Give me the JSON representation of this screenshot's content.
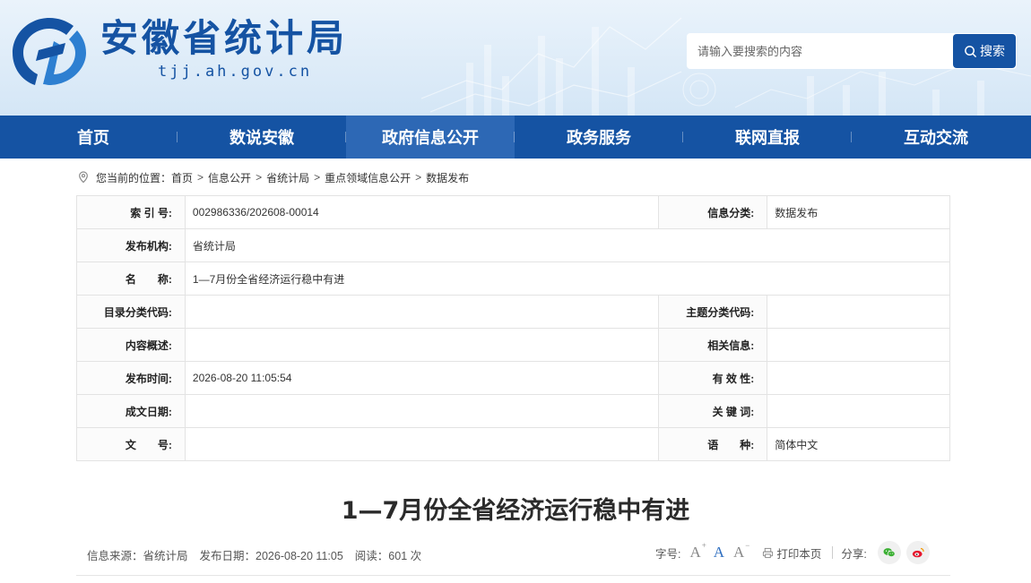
{
  "header": {
    "site_name": "安徽省统计局",
    "site_url": "tjj.ah.gov.cn",
    "search_placeholder": "请输入要搜索的内容",
    "search_button": "搜索",
    "colors": {
      "brand_blue": "#1553a3",
      "nav_active": "#2d68b5"
    }
  },
  "nav": {
    "items": [
      "首页",
      "数说安徽",
      "政府信息公开",
      "政务服务",
      "联网直报",
      "互动交流"
    ],
    "active": "政府信息公开"
  },
  "breadcrumb": {
    "prefix": "您当前的位置：",
    "items": [
      "首页",
      "信息公开",
      "省统计局",
      "重点领域信息公开",
      "数据发布"
    ],
    "separator": ">"
  },
  "meta": {
    "index_no_label": "索 引 号:",
    "index_no": "002986336/202608-00014",
    "category_label": "信息分类:",
    "category": "数据发布",
    "publisher_label": "发布机构:",
    "publisher": "省统计局",
    "name_label": "名　　称:",
    "name": "1—7月份全省经济运行稳中有进",
    "catalog_code_label": "目录分类代码:",
    "catalog_code": "",
    "topic_code_label": "主题分类代码:",
    "topic_code": "",
    "summary_label": "内容概述:",
    "summary": "",
    "related_label": "相关信息:",
    "related": "",
    "publish_time_label": "发布时间:",
    "publish_time": "2026-08-20 11:05:54",
    "validity_label": "有 效 性:",
    "validity": "",
    "written_date_label": "成文日期:",
    "written_date": "",
    "keywords_label": "关 键 词:",
    "keywords": "",
    "doc_no_label": "文　　号:",
    "doc_no": "",
    "language_label": "语　　种:",
    "language": "简体中文"
  },
  "article": {
    "title": "1—7月份全省经济运行稳中有进",
    "source": "信息来源：省统计局",
    "date": "发布日期：2026-08-20 11:05",
    "views": "阅读：601 次",
    "font_size_label": "字号:",
    "font_buttons": [
      "A",
      "A",
      "A"
    ],
    "print_label": "打印本页",
    "share_label": "分享:"
  }
}
